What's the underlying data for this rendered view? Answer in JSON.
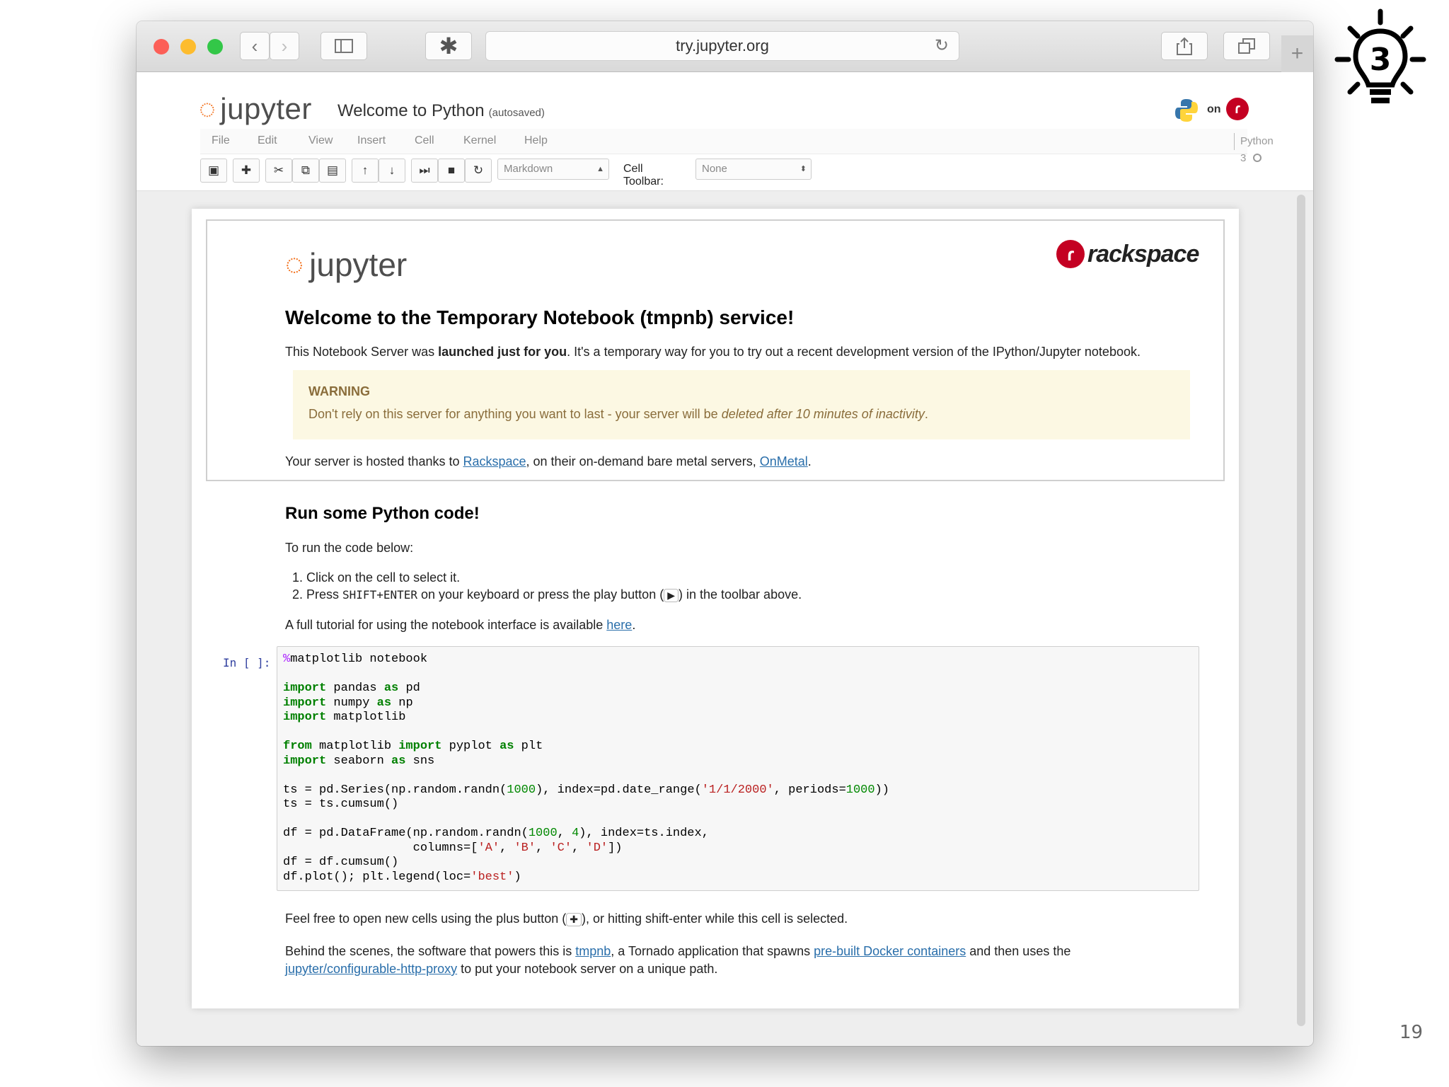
{
  "browser": {
    "url": "try.jupyter.org",
    "back_icon": "chevron-left",
    "forward_icon": "chevron-right",
    "sidebar_icon": "sidebar",
    "extension_icon": "puzzle",
    "reload_icon": "reload",
    "share_icon": "share",
    "tabs_icon": "tabs",
    "new_tab_icon": "plus"
  },
  "header": {
    "logo_text": "jupyter",
    "notebook_title": "Welcome to Python",
    "autosave_status": "(autosaved)",
    "on_text": "on",
    "kernel_name": "Python 3"
  },
  "menu": [
    "File",
    "Edit",
    "View",
    "Insert",
    "Cell",
    "Kernel",
    "Help"
  ],
  "toolbar": {
    "cell_type": "Markdown",
    "cell_toolbar_label": "Cell Toolbar:",
    "cell_toolbar_value": "None"
  },
  "intro": {
    "logo_text": "jupyter",
    "sponsor_text": "rackspace",
    "heading": "Welcome to the Temporary Notebook (tmpnb) service!",
    "p1_before": "This Notebook Server was ",
    "p1_bold": "launched just for you",
    "p1_after": ". It's a temporary way for you to try out a recent development version of the IPython/Jupyter notebook.",
    "warning_title": "WARNING",
    "warning_before": "Don't rely on this server for anything you want to last - your server will be ",
    "warning_italic": "deleted after 10 minutes of inactivity",
    "warning_after": ".",
    "hosted_before": "Your server is hosted thanks to ",
    "hosted_link1": "Rackspace",
    "hosted_middle": ", on their on-demand bare metal servers, ",
    "hosted_link2": "OnMetal",
    "hosted_after": "."
  },
  "run": {
    "heading": "Run some Python code!",
    "intro": "To run the code below:",
    "step1": "1.  Click on the cell to select it.",
    "step2_before": "2.  Press ",
    "step2_key": "SHIFT+ENTER",
    "step2_middle": " on your keyboard or press the play button (",
    "step2_after": ") in the toolbar above.",
    "tutorial_before": "A full tutorial for using the notebook interface is available ",
    "tutorial_link": "here",
    "tutorial_after": "."
  },
  "code_cell": {
    "prompt": "In [ ]:"
  },
  "footer_text": {
    "new_cells_before": "Feel free to open new cells using the plus button (",
    "new_cells_after": "), or hitting shift-enter while this cell is selected.",
    "behind_before": "Behind the scenes, the software that powers this is ",
    "behind_link1": "tmpnb",
    "behind_middle": ", a Tornado application that spawns ",
    "behind_link2": "pre-built Docker containers",
    "behind_after": " and then uses the",
    "behind_link3": "jupyter/configurable-http-proxy",
    "behind_end": " to put your notebook server on a unique path."
  },
  "slide": {
    "badge_number": "3",
    "page_number": "19"
  }
}
